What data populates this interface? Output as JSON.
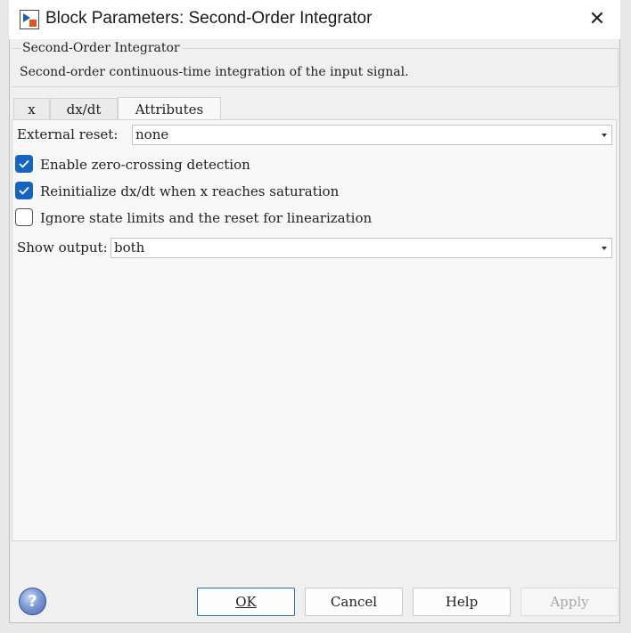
{
  "window": {
    "title": "Block Parameters: Second-Order Integrator",
    "close_icon": "close-icon",
    "app_icon": "simulink-block-icon"
  },
  "description": {
    "group_title": "Second-Order Integrator",
    "text": "Second-order continuous-time integration of the input signal."
  },
  "tabs": [
    {
      "label": "x",
      "active": false
    },
    {
      "label": "dx/dt",
      "active": false
    },
    {
      "label": "Attributes",
      "active": true
    }
  ],
  "attributes": {
    "external_reset_label": "External reset:",
    "external_reset_value": "none",
    "zero_crossing_label": "Enable zero-crossing detection",
    "zero_crossing_checked": true,
    "reinit_label": "Reinitialize dx/dt when x reaches saturation",
    "reinit_checked": true,
    "ignore_limits_label": "Ignore state limits and the reset for linearization",
    "ignore_limits_checked": false,
    "show_output_label": "Show output:",
    "show_output_value": "both"
  },
  "buttons": {
    "ok": "OK",
    "cancel": "Cancel",
    "help": "Help",
    "apply": "Apply"
  },
  "colors": {
    "accent": "#1565c0"
  }
}
